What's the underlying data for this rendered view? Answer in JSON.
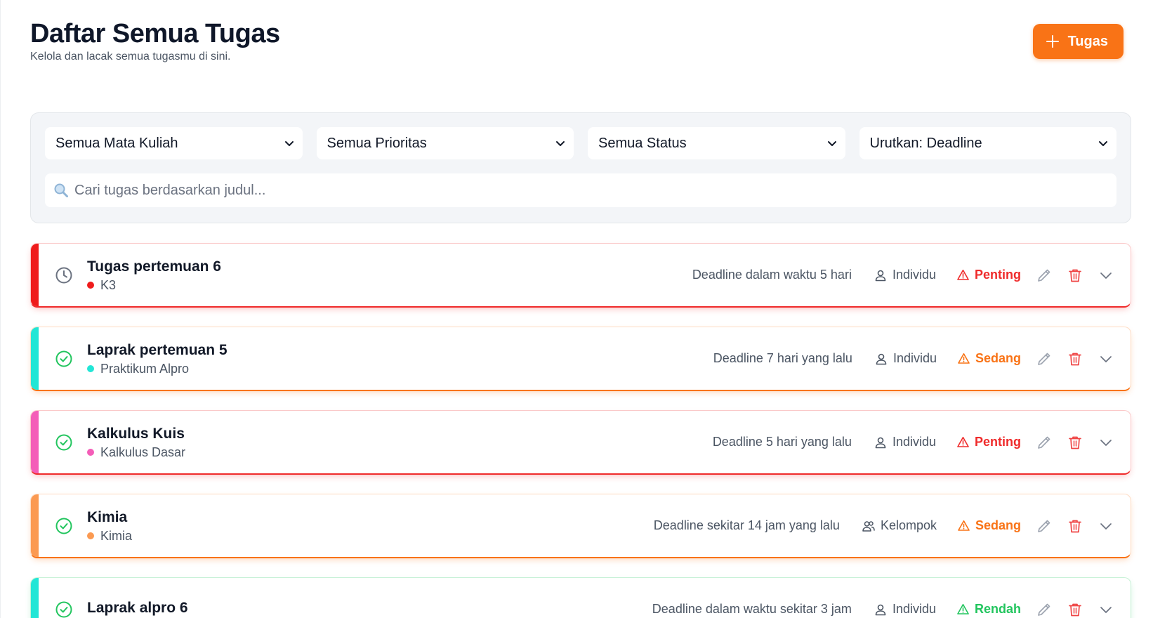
{
  "page": {
    "title": "Daftar Semua Tugas",
    "subtitle": "Kelola dan lacak semua tugasmu di sini.",
    "add_button_label": "Tugas"
  },
  "filters": {
    "course": "Semua Mata Kuliah",
    "priority": "Semua Prioritas",
    "status": "Semua Status",
    "sort": "Urutkan: Deadline",
    "search_placeholder": "Cari tugas berdasarkan judul..."
  },
  "colors": {
    "accent": "#f97316",
    "priority_penting": "#ef2b2b",
    "priority_sedang": "#f97316",
    "priority_rendah": "#22c55e",
    "status_done": "#22c55e",
    "status_pending": "#6b7280"
  },
  "tasks": [
    {
      "title": "Tugas pertemuan 6",
      "course": "K3",
      "course_color": "#ef1c1c",
      "status_icon": "clock-icon",
      "deadline": "Deadline dalam waktu 5 hari",
      "type": "Individu",
      "type_icon": "user-icon",
      "priority": "Penting",
      "priority_key": "penting"
    },
    {
      "title": "Laprak pertemuan 5",
      "course": "Praktikum Alpro",
      "course_color": "#22e6d6",
      "status_icon": "check-circle-icon",
      "deadline": "Deadline 7 hari yang lalu",
      "type": "Individu",
      "type_icon": "user-icon",
      "priority": "Sedang",
      "priority_key": "sedang"
    },
    {
      "title": "Kalkulus Kuis",
      "course": "Kalkulus Dasar",
      "course_color": "#f45db8",
      "status_icon": "check-circle-icon",
      "deadline": "Deadline 5 hari yang lalu",
      "type": "Individu",
      "type_icon": "user-icon",
      "priority": "Penting",
      "priority_key": "penting"
    },
    {
      "title": "Kimia",
      "course": "Kimia",
      "course_color": "#fb9a52",
      "status_icon": "check-circle-icon",
      "deadline": "Deadline sekitar 14 jam yang lalu",
      "type": "Kelompok",
      "type_icon": "users-icon",
      "priority": "Sedang",
      "priority_key": "sedang"
    },
    {
      "title": "Laprak alpro 6",
      "course": "",
      "course_color": "#22e6d6",
      "status_icon": "check-circle-icon",
      "deadline": "Deadline dalam waktu sekitar 3 jam",
      "type": "Individu",
      "type_icon": "user-icon",
      "priority": "Rendah",
      "priority_key": "rendah"
    }
  ]
}
